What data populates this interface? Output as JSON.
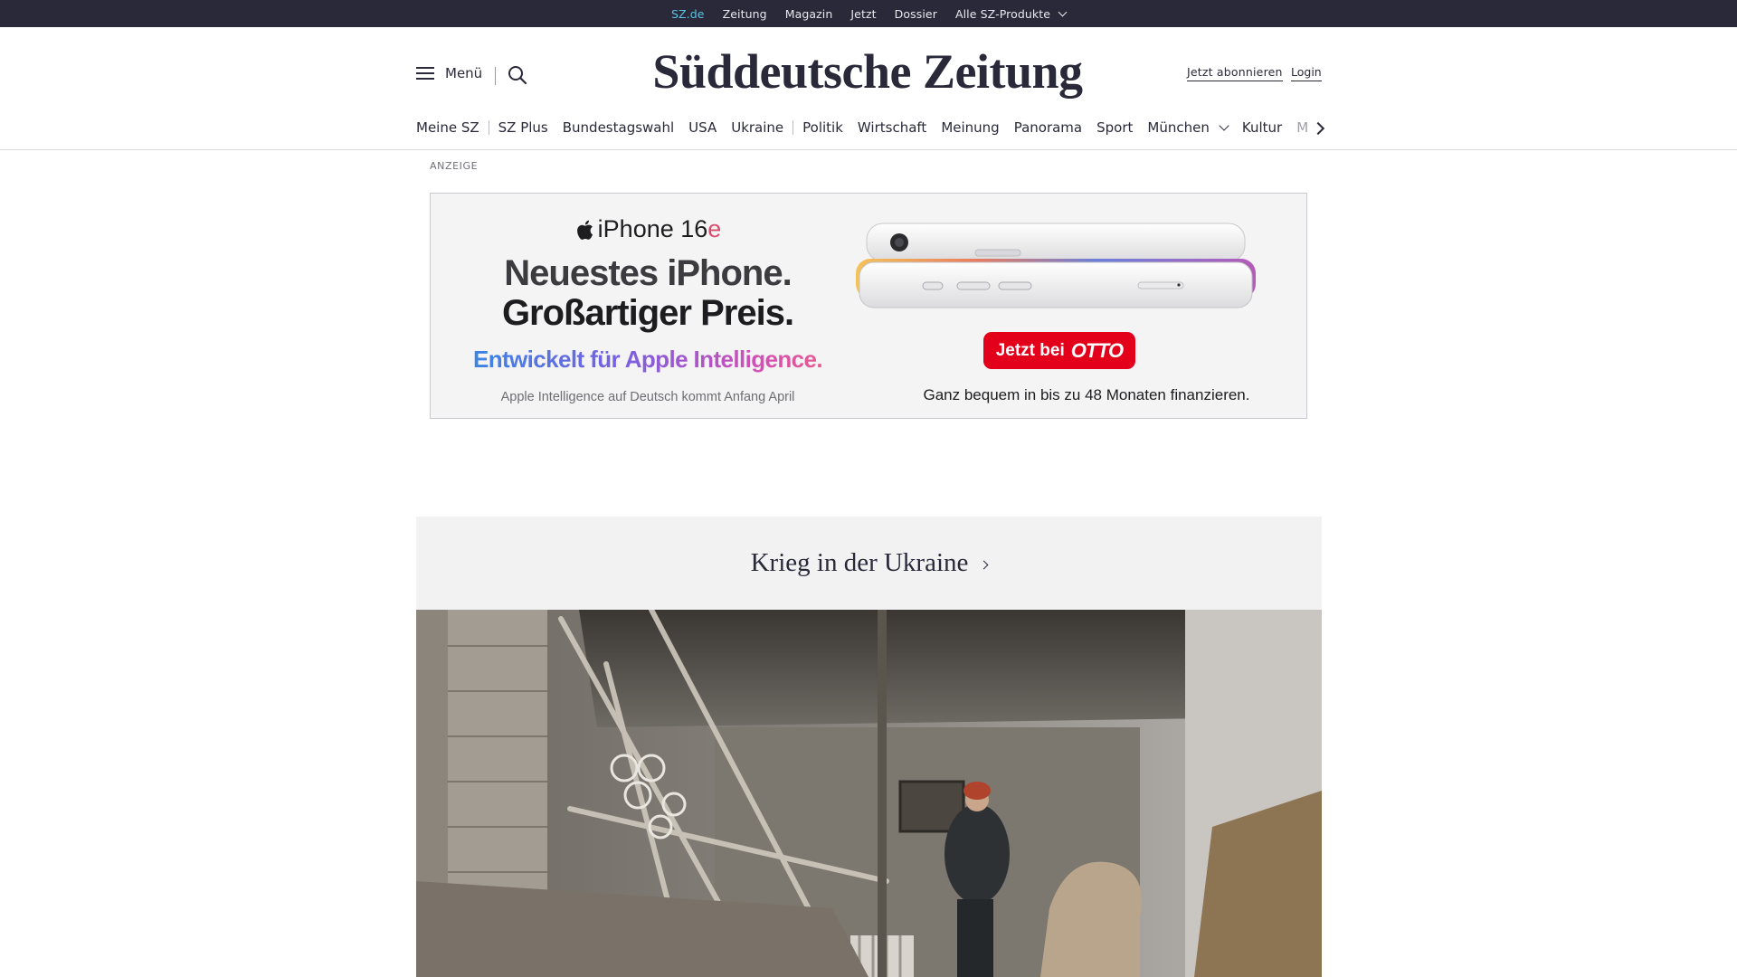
{
  "topbar": {
    "links": [
      "SZ.de",
      "Zeitung",
      "Magazin",
      "Jetzt",
      "Dossier",
      "Alle SZ-Produkte"
    ]
  },
  "header": {
    "menu_label": "Menü",
    "logo_text": "Süddeutsche Zeitung",
    "subscribe_label": "Jetzt abonnieren",
    "login_label": "Login"
  },
  "nav": {
    "items": [
      "Meine SZ",
      "SZ Plus",
      "Bundestagswahl",
      "USA",
      "Ukraine",
      "Politik",
      "Wirtschaft",
      "Meinung",
      "Panorama",
      "Sport",
      "München",
      "Kultur",
      "M"
    ]
  },
  "ad": {
    "label": "ANZEIGE",
    "product_name": "iPhone 16",
    "product_suffix": "e",
    "headline_line1": "Neuestes iPhone.",
    "headline_line2": "Großartiger Preis.",
    "tagline": "Entwickelt für Apple Intelligence.",
    "note": "Apple Intelligence auf Deutsch kommt Anfang April",
    "cta_label": "Jetzt bei",
    "cta_brand": "OTTO",
    "finance_text": "Ganz bequem in bis zu 48 Monaten finanzieren.",
    "colors": {
      "cta": "#e3001b",
      "product_suffix": "#d94c6e"
    }
  },
  "topic": {
    "title": "Krieg in der Ukraine"
  },
  "colors": {
    "topbar_bg": "#29293a",
    "active_link": "#5cc2df",
    "text": "#29293a",
    "topic_bg": "#f2f2f3"
  }
}
